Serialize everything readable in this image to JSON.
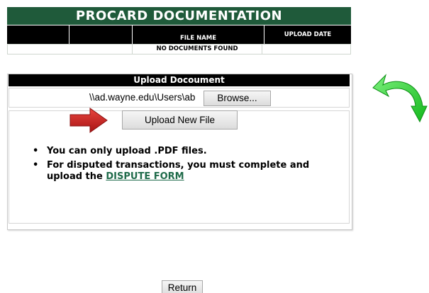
{
  "documentation": {
    "title": "PROCARD DOCUMENTATION",
    "columns": [
      "",
      "",
      "FILE NAME",
      "UPLOAD DATE"
    ],
    "empty_message": "NO DOCUMENTS FOUND",
    "header_color": "#1f5a3a"
  },
  "upload": {
    "title": "Upload Docoument",
    "file_path": "\\\\ad.wayne.edu\\Users\\ab",
    "browse_label": "Browse...",
    "upload_label": "Upload New File",
    "notes": [
      "You can only upload .PDF files.",
      "For disputed transactions, you must complete and upload the "
    ],
    "dispute_link": "DISPUTE FORM",
    "link_color": "#1f6b4a"
  },
  "annotations": {
    "red_arrow": "red-arrow-icon",
    "green_arrow": "green-curved-arrow-icon",
    "red_color": "#cc1f1f",
    "green_color": "#1fd12a"
  },
  "footer": {
    "return_label": "Return"
  }
}
